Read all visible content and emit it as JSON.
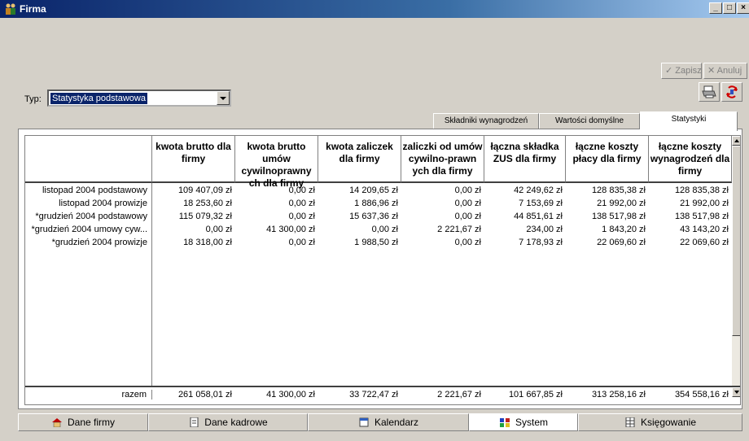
{
  "window": {
    "title": "Firma",
    "minimize": "_",
    "maximize": "□",
    "close": "×"
  },
  "toolbar": {
    "save_label": "✓ Zapisz",
    "cancel_label": "✕ Anuluj",
    "print_icon": "printer-icon",
    "refresh_icon": "refresh-icon"
  },
  "typ": {
    "label": "Typ:",
    "value": "Statystyka podstawowa"
  },
  "tabs": [
    {
      "label": "Składniki wynagrodzeń",
      "active": false
    },
    {
      "label": "Wartości domyślne",
      "active": false
    },
    {
      "label": "Statystyki",
      "active": true
    }
  ],
  "table": {
    "headers": [
      "",
      "kwota brutto dla firmy",
      "kwota brutto umów cywilnoprawny ch dla firmy",
      "kwota zaliczek dla firmy",
      "zaliczki od umów cywilno-prawn ych dla firmy",
      "łączna składka ZUS dla firmy",
      "łączne koszty płacy dla firmy",
      "łączne koszty wynagrodzeń dla firmy"
    ],
    "rows": [
      {
        "label": "listopad 2004 podstawowy",
        "values": [
          "109 407,09 zł",
          "0,00 zł",
          "14 209,65 zł",
          "0,00 zł",
          "42 249,62 zł",
          "128 835,38 zł",
          "128 835,38 zł"
        ]
      },
      {
        "label": "listopad 2004 prowizje",
        "values": [
          "18 253,60 zł",
          "0,00 zł",
          "1 886,96 zł",
          "0,00 zł",
          "7 153,69 zł",
          "21 992,00 zł",
          "21 992,00 zł"
        ]
      },
      {
        "label": "*grudzień 2004 podstawowy",
        "values": [
          "115 079,32 zł",
          "0,00 zł",
          "15 637,36 zł",
          "0,00 zł",
          "44 851,61 zł",
          "138 517,98 zł",
          "138 517,98 zł"
        ]
      },
      {
        "label": "*grudzień 2004 umowy cyw...",
        "values": [
          "0,00 zł",
          "41 300,00 zł",
          "0,00 zł",
          "2 221,67 zł",
          "234,00 zł",
          "1 843,20 zł",
          "43 143,20 zł"
        ]
      },
      {
        "label": "*grudzień 2004 prowizje",
        "values": [
          "18 318,00 zł",
          "0,00 zł",
          "1 988,50 zł",
          "0,00 zł",
          "7 178,93 zł",
          "22 069,60 zł",
          "22 069,60 zł"
        ]
      }
    ],
    "total": {
      "label": "razem",
      "values": [
        "261 058,01 zł",
        "41 300,00 zł",
        "33 722,47 zł",
        "2 221,67 zł",
        "101 667,85 zł",
        "313 258,16 zł",
        "354 558,16 zł"
      ]
    }
  },
  "bottom_tabs": [
    {
      "label": "Dane firmy",
      "icon": "house-icon",
      "active": false
    },
    {
      "label": "Dane kadrowe",
      "icon": "document-icon",
      "active": false
    },
    {
      "label": "Kalendarz",
      "icon": "calendar-icon",
      "active": false
    },
    {
      "label": "System",
      "icon": "system-icon",
      "active": true
    },
    {
      "label": "Księgowanie",
      "icon": "ledger-icon",
      "active": false
    }
  ]
}
